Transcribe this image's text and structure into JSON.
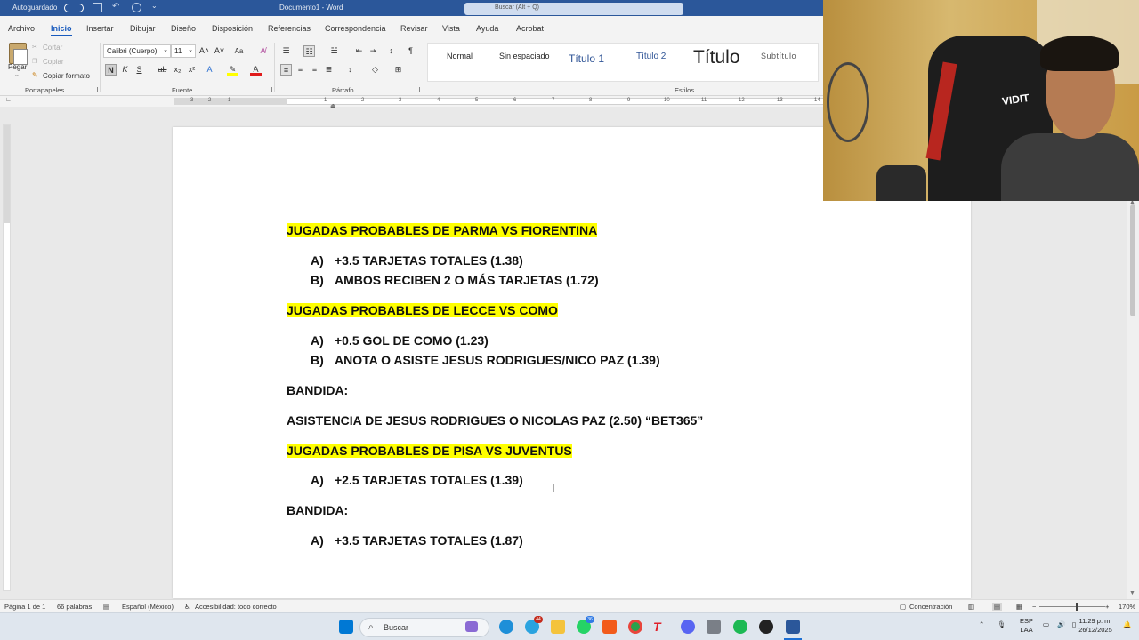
{
  "titlebar": {
    "autosave": "Autoguardado",
    "document_title": "Documento1 - Word",
    "search_placeholder": "Buscar (Alt + Q)"
  },
  "ribbon_tabs": [
    "Archivo",
    "Inicio",
    "Insertar",
    "Dibujar",
    "Diseño",
    "Disposición",
    "Referencias",
    "Correspondencia",
    "Revisar",
    "Vista",
    "Ayuda",
    "Acrobat"
  ],
  "active_tab": "Inicio",
  "clipboard": {
    "paste": "Pegar",
    "cut": "Cortar",
    "copy": "Copiar",
    "format_painter": "Copiar formato",
    "label": "Portapapeles"
  },
  "font": {
    "name": "Calibri (Cuerpo)",
    "size": "11",
    "label": "Fuente",
    "bold": "N",
    "italic": "K",
    "underline": "S"
  },
  "paragraph": {
    "label": "Párrafo"
  },
  "styles": {
    "label": "Estilos",
    "items": [
      "Normal",
      "Sin espaciado",
      "Título 1",
      "Título 2",
      "Título",
      "Subtítulo"
    ]
  },
  "ruler_numbers": [
    "3",
    "2",
    "1",
    "1",
    "2",
    "3",
    "4",
    "5",
    "6",
    "7",
    "8",
    "9",
    "10",
    "11",
    "12",
    "13",
    "14"
  ],
  "document": {
    "heading1": "JUGADAS PROBABLES DE PARMA VS FIORENTINA",
    "list1": [
      {
        "marker": "A)",
        "text": "+3.5 TARJETAS TOTALES (1.38)"
      },
      {
        "marker": "B)",
        "text": "AMBOS RECIBEN 2 O MÁS TARJETAS (1.72)"
      }
    ],
    "heading2": "JUGADAS PROBABLES DE LECCE VS COMO",
    "list2": [
      {
        "marker": "A)",
        "text": "+0.5 GOL DE COMO (1.23)"
      },
      {
        "marker": "B)",
        "text": "ANOTA O ASISTE JESUS RODRIGUES/NICO PAZ (1.39)"
      }
    ],
    "bandida1": "BANDIDA:",
    "bandida1_text": "ASISTENCIA DE JESUS RODRIGUES O NICOLAS PAZ (2.50) “BET365”",
    "heading3": "JUGADAS PROBABLES DE PISA VS JUVENTUS",
    "list3": [
      {
        "marker": "A)",
        "text": "+2.5 TARJETAS TOTALES (1.39)"
      }
    ],
    "bandida2": "BANDIDA:",
    "list4": [
      {
        "marker": "A)",
        "text": "+3.5 TARJETAS TOTALES (1.87)"
      }
    ]
  },
  "webcam": {
    "chair_text": "VIDIT"
  },
  "statusbar": {
    "page": "Página 1 de 1",
    "words": "66 palabras",
    "language": "Español (México)",
    "accessibility": "Accesibilidad: todo correcto",
    "focus": "Concentración",
    "zoom": "170%"
  },
  "taskbar": {
    "search": "Buscar",
    "badge_telegram": "44",
    "badge_whatsapp": "36",
    "lang_top": "ESP",
    "lang_bottom": "LAA",
    "time": "11:29 p. m.",
    "date": "26/12/2025"
  },
  "colors": {
    "word_blue": "#2b579a",
    "highlight": "#ffff00",
    "accent": "#185abd"
  }
}
